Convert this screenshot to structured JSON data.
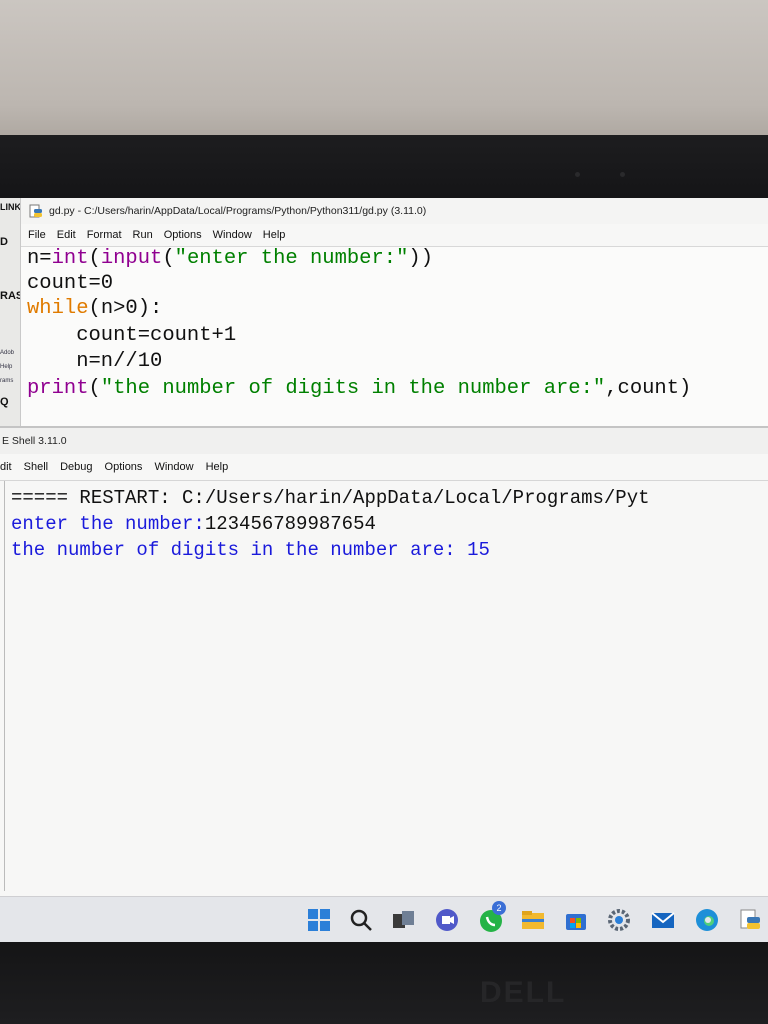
{
  "desktop": {
    "labels": [
      "LINK",
      "D",
      "RAS",
      "Adob",
      "Help",
      "rams",
      "Q"
    ]
  },
  "editor": {
    "title": "gd.py - C:/Users/harin/AppData/Local/Programs/Python/Python311/gd.py (3.11.0)",
    "menu": [
      "File",
      "Edit",
      "Format",
      "Run",
      "Options",
      "Window",
      "Help"
    ],
    "code": {
      "l1_a": "n=",
      "l1_b": "int",
      "l1_c": "(",
      "l1_d": "input",
      "l1_e": "(",
      "l1_f": "\"enter the number:\"",
      "l1_g": "))",
      "l2": "count=0",
      "l3_a": "while",
      "l3_b": "(n>0):",
      "l4": "    count=count+1",
      "l5": "    n=n//10",
      "l6_a": "print",
      "l6_b": "(",
      "l6_c": "\"the number of digits in the number are:\"",
      "l6_d": ",count)"
    }
  },
  "shell": {
    "title": "E Shell 3.11.0",
    "menu": [
      "dit",
      "Shell",
      "Debug",
      "Options",
      "Window",
      "Help"
    ],
    "lines": [
      "===== RESTART: C:/Users/harin/AppData/Local/Programs/Pyt",
      "enter the number:",
      "123456789987654",
      "the number of digits in the number are: 15"
    ]
  },
  "taskbar": {
    "whatsapp_badge": "2",
    "icons": [
      "start-icon",
      "search-icon",
      "task-view-icon",
      "teams-icon",
      "whatsapp-icon",
      "file-explorer-icon",
      "store-icon",
      "settings-icon",
      "mail-icon",
      "edge-icon",
      "python-icon"
    ]
  },
  "bezel": {
    "brand": "DELL"
  }
}
